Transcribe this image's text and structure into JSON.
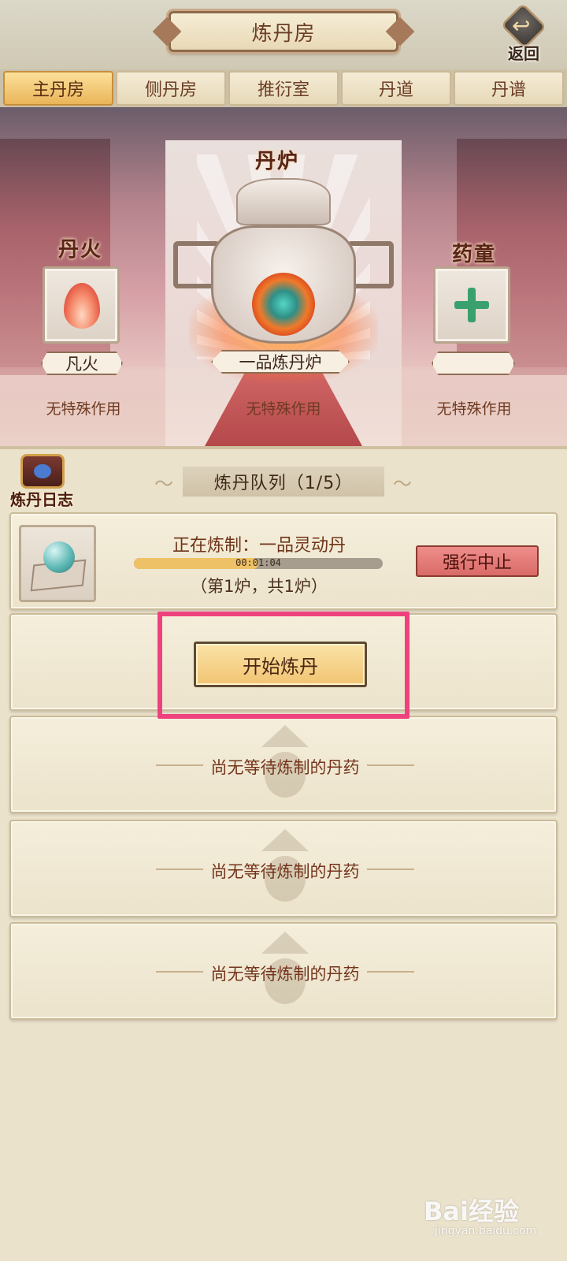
{
  "header": {
    "title": "炼丹房",
    "back_label": "返回"
  },
  "tabs": [
    {
      "label": "主丹房",
      "active": true
    },
    {
      "label": "侧丹房",
      "active": false
    },
    {
      "label": "推衍室",
      "active": false
    },
    {
      "label": "丹道",
      "active": false
    },
    {
      "label": "丹谱",
      "active": false
    }
  ],
  "scene": {
    "fire": {
      "title": "丹火",
      "name": "凡火",
      "effect": "无特殊作用"
    },
    "furnace": {
      "title": "丹炉",
      "name": "一品炼丹炉",
      "effect": "无特殊作用"
    },
    "attendant": {
      "title": "药童",
      "name": "",
      "effect": "无特殊作用"
    }
  },
  "queue": {
    "log_label": "炼丹日志",
    "title": "炼丹队列（1/5）",
    "active": {
      "status": "正在炼制：一品灵动丹",
      "time": "00:01:04",
      "progress": 0.5,
      "count": "（第1炉，共1炉）",
      "stop_label": "强行中止"
    },
    "start_label": "开始炼丹",
    "empty_text": "尚无等待炼制的丹药"
  },
  "watermark": {
    "logo": "Bai经验",
    "url": "jingyan.baidu.com"
  },
  "colors": {
    "highlight": "#f0417f",
    "tab_active": "#eab55a",
    "stop_button": "#d96b68"
  }
}
